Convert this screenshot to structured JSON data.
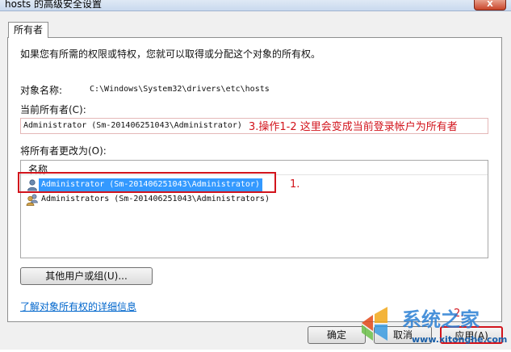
{
  "window": {
    "title": "hosts 的高级安全设置",
    "close_glyph": "X"
  },
  "tabs": [
    {
      "label": "所有者"
    }
  ],
  "owner_page": {
    "intro": "如果您有所需的权限或特权，您就可以取得或分配这个对象的所有权。",
    "object_name_label": "对象名称:",
    "object_name_value": "C:\\Windows\\System32\\drivers\\etc\\hosts",
    "current_owner_label": "当前所有者(C):",
    "current_owner_value": "Administrator (Sm-201406251043\\Administrator)",
    "change_owner_label": "将所有者更改为(O):",
    "list": {
      "column_header": "名称",
      "rows": [
        {
          "label": "Administrator (Sm-201406251043\\Administrator)",
          "icon": "user-icon",
          "selected": true
        },
        {
          "label": "Administrators (Sm-201406251043\\Administrators)",
          "icon": "user-group-icon",
          "selected": false
        }
      ]
    },
    "other_users_button": "其他用户或组(U)...",
    "learn_more_link": "了解对象所有权的详细信息"
  },
  "buttons": {
    "ok": "确定",
    "cancel": "取消",
    "apply": "应用(A)"
  },
  "annotations": {
    "step1": "1.",
    "step2": "2.",
    "step3": "3.操作1-2 这里会变成当前登录帐户为所有者"
  },
  "watermark": {
    "brand_main": "系统之家",
    "brand_url": "www.xitonghe.com"
  },
  "colors": {
    "selection": "#3399ff",
    "annotation_red": "#d2141c",
    "link": "#0066cc"
  }
}
